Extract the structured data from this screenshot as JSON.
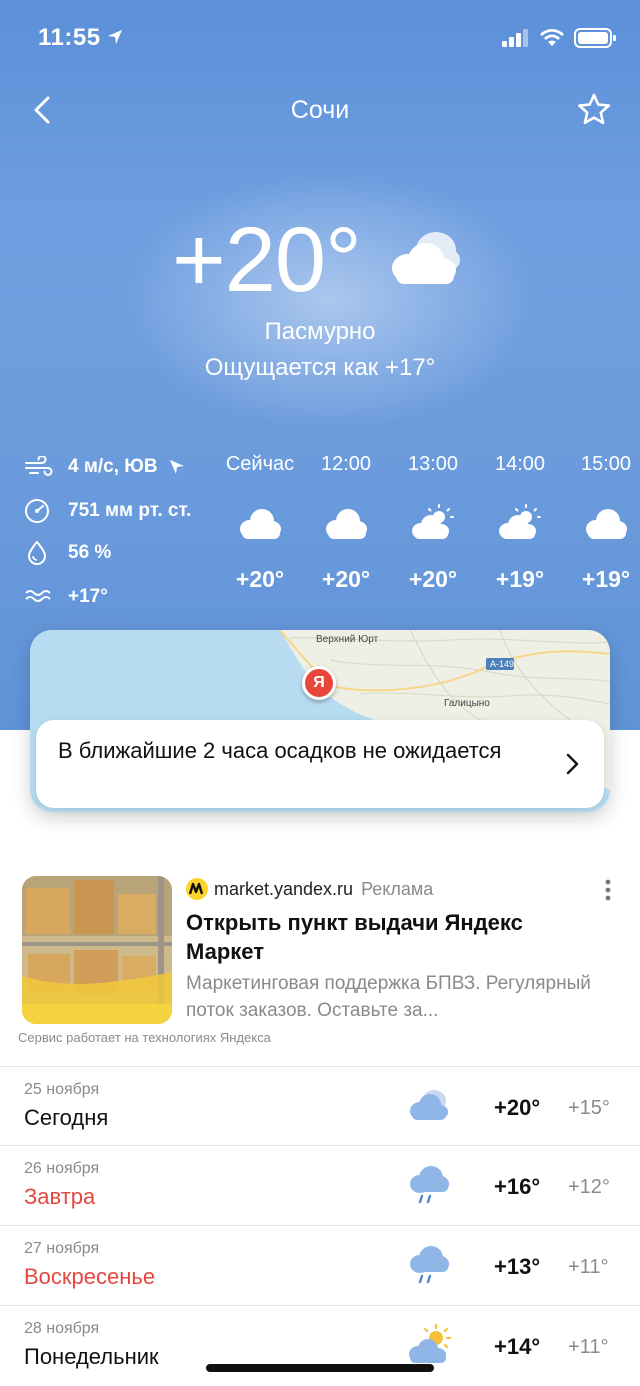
{
  "status_bar": {
    "time": "11:55"
  },
  "nav": {
    "title": "Сочи"
  },
  "current": {
    "temperature": "+20°",
    "condition": "Пасмурно",
    "feels_like": "Ощущается как +17°"
  },
  "details": {
    "wind": "4 м/с, ЮВ",
    "pressure": "751 мм рт. ст.",
    "humidity": "56 %",
    "water": "+17°"
  },
  "hourly": [
    {
      "label": "Сейчас",
      "temp": "+20°",
      "icon": "cloud-icon"
    },
    {
      "label": "12:00",
      "temp": "+20°",
      "icon": "cloud-icon"
    },
    {
      "label": "13:00",
      "temp": "+20°",
      "icon": "partly-cloudy-icon"
    },
    {
      "label": "14:00",
      "temp": "+19°",
      "icon": "partly-cloudy-icon"
    },
    {
      "label": "15:00",
      "temp": "+19°",
      "icon": "cloud-icon"
    }
  ],
  "map": {
    "label_village": "Верхний Юрт",
    "label_road": "A-149",
    "label_town": "Галицыно",
    "pin_letter": "Я"
  },
  "precipitation": {
    "text": "В ближайшие 2 часа осадков не ожидается"
  },
  "ad": {
    "source": "market.yandex.ru",
    "mark": "Реклама",
    "title": "Открыть пункт выдачи Яндекс Маркет",
    "description": "Маркетинговая поддержка БПВЗ. Регулярный поток заказов. Оставьте за...",
    "service_note": "Сервис работает на технологиях Яндекса"
  },
  "forecast": [
    {
      "date": "25 ноября",
      "name": "Сегодня",
      "hi": "+20°",
      "lo": "+15°",
      "icon": "cloud-icon",
      "weekend": false
    },
    {
      "date": "26 ноября",
      "name": "Завтра",
      "hi": "+16°",
      "lo": "+12°",
      "icon": "rain-icon",
      "weekend": true
    },
    {
      "date": "27 ноября",
      "name": "Воскресенье",
      "hi": "+13°",
      "lo": "+11°",
      "icon": "rain-icon",
      "weekend": true
    },
    {
      "date": "28 ноября",
      "name": "Понедельник",
      "hi": "+14°",
      "lo": "+11°",
      "icon": "partly-cloudy-icon",
      "weekend": false
    }
  ],
  "colors": {
    "sky_top": "#5b8fd8",
    "weekend_red": "#e5473e",
    "pin": "#e8463a"
  }
}
